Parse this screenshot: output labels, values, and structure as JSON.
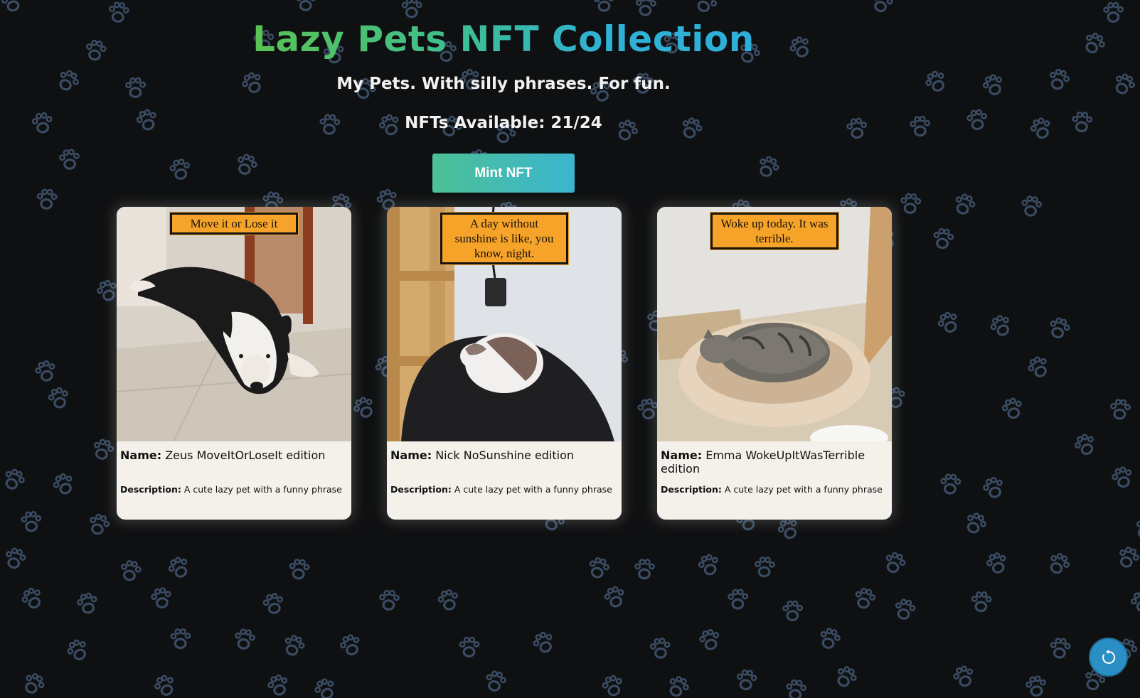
{
  "header": {
    "title": "Lazy Pets NFT Collection",
    "subtitle": "My Pets. With silly phrases. For fun.",
    "available_label": "NFTs Available: 21/24"
  },
  "mint_button": {
    "label": "Mint NFT"
  },
  "labels": {
    "name": "Name:",
    "description": "Description:"
  },
  "cards": [
    {
      "phrase": "Move it or Lose it",
      "name": "Zeus MoveItOrLoseIt edition",
      "description": "A cute lazy pet with a funny phrase"
    },
    {
      "phrase": "A day without sunshine is like, you know, night.",
      "name": "Nick NoSunshine edition",
      "description": "A cute lazy pet with a funny phrase"
    },
    {
      "phrase": "Woke up today. It was terrible.",
      "name": "Emma WokeUpItWasTerrible edition",
      "description": "A cute lazy pet with a funny phrase"
    }
  ],
  "icons": {
    "background": "paw-print-icon",
    "refresh": "refresh-icon"
  },
  "colors": {
    "background": "#0f1011",
    "paw": "#3a4c63",
    "title_green": "#5ec34a",
    "title_blue": "#2aa7dc",
    "card": "#f4f0ea",
    "phrase_box": "#f6a32a",
    "refresh_button": "#2a8fc4"
  }
}
